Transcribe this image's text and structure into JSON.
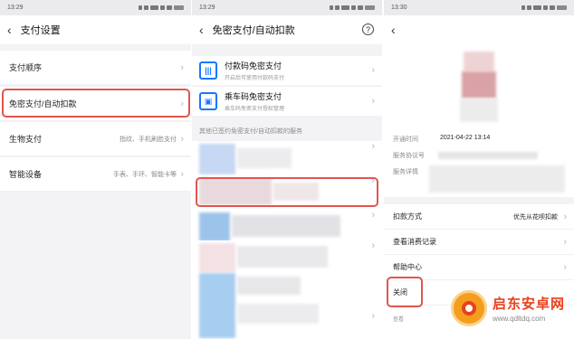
{
  "screen1": {
    "status_time": "13:29",
    "title": "支付设置",
    "rows": [
      {
        "label": "支付顺序",
        "hint": ""
      },
      {
        "label": "免密支付/自动扣款",
        "hint": ""
      },
      {
        "label": "生物支付",
        "hint": "指纹、手机刷脸支付"
      },
      {
        "label": "智能设备",
        "hint": "手表、手环、智能卡等"
      }
    ]
  },
  "screen2": {
    "status_time": "13:29",
    "title": "免密支付/自动扣款",
    "help_icon": "?",
    "items": [
      {
        "title": "付款码免密支付",
        "subtitle": "开启后可使用付款码支付",
        "icon": "barcode-icon"
      },
      {
        "title": "乘车码免密支付",
        "subtitle": "乘车码免密支付授权管理",
        "icon": "bus-card-icon"
      }
    ],
    "section_label": "其他已签约免密支付/自动扣款的服务"
  },
  "screen3": {
    "status_time": "13:30",
    "fields": [
      {
        "label": "开通时间",
        "value": "2021-04-22 13:14"
      },
      {
        "label": "服务协议号",
        "value": ""
      },
      {
        "label": "服务详情",
        "value": ""
      }
    ],
    "rows": [
      {
        "label": "扣款方式",
        "value": "优先从花呗扣款"
      },
      {
        "label": "查看消费记录",
        "value": ""
      },
      {
        "label": "帮助中心",
        "value": ""
      },
      {
        "label": "关闭",
        "value": ""
      }
    ],
    "bottom_hint": "查看"
  },
  "watermark": {
    "title": "启东安卓网",
    "url": "www.qdltdq.com"
  },
  "colors": {
    "highlight": "#e0564e",
    "accent": "#1677ff"
  }
}
